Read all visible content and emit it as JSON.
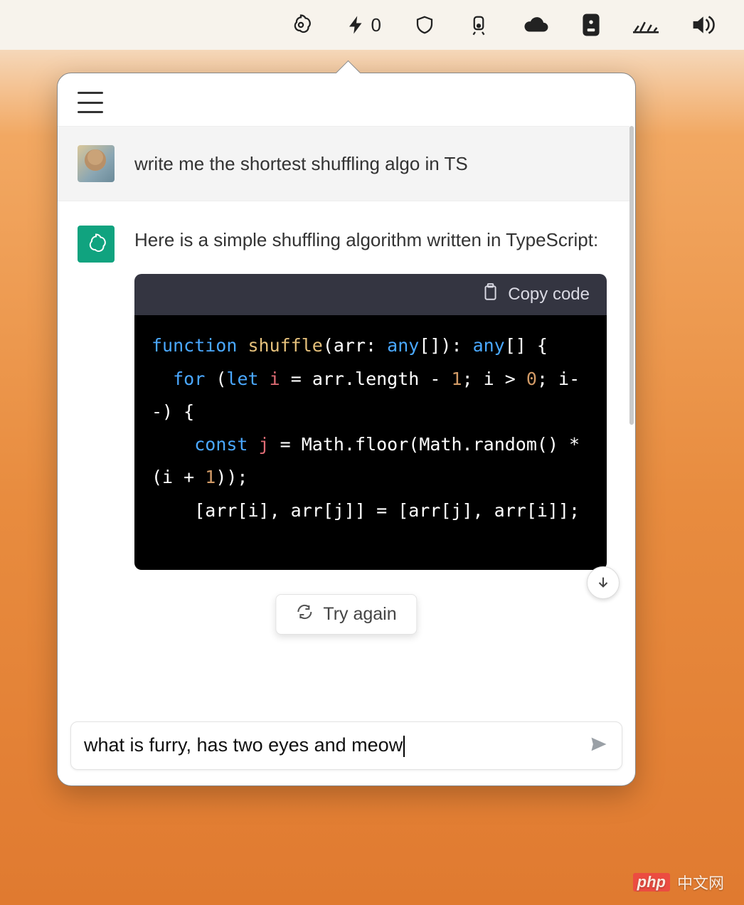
{
  "menubar": {
    "bolt_count": "0",
    "icons": [
      "openai-icon",
      "bolt-icon",
      "shield-icon",
      "train-icon",
      "cloud-icon",
      "badge-icon",
      "brightness-icon",
      "volume-icon"
    ]
  },
  "popover": {
    "header": {
      "menu_name": "hamburger-menu"
    }
  },
  "chat": {
    "user_message": "write me the shortest shuffling algo in TS",
    "ai_intro": "Here is a simple shuffling algorithm written in TypeScript:",
    "code": {
      "copy_label": "Copy code",
      "tokens": [
        {
          "t": "function ",
          "c": "b"
        },
        {
          "t": "shuffle",
          "c": "y"
        },
        {
          "t": "(arr: ",
          "c": "g"
        },
        {
          "t": "any",
          "c": "b"
        },
        {
          "t": "[]): ",
          "c": "g"
        },
        {
          "t": "any",
          "c": "b"
        },
        {
          "t": "[] {\n",
          "c": "g"
        },
        {
          "t": "  for ",
          "c": "b"
        },
        {
          "t": "(",
          "c": "g"
        },
        {
          "t": "let ",
          "c": "b"
        },
        {
          "t": "i",
          "c": "r"
        },
        {
          "t": " = arr.length - ",
          "c": "g"
        },
        {
          "t": "1",
          "c": "n"
        },
        {
          "t": "; i > ",
          "c": "g"
        },
        {
          "t": "0",
          "c": "n"
        },
        {
          "t": "; i--) {\n",
          "c": "g"
        },
        {
          "t": "    const ",
          "c": "b"
        },
        {
          "t": "j",
          "c": "r"
        },
        {
          "t": " = ",
          "c": "g"
        },
        {
          "t": "Math",
          "c": "g"
        },
        {
          "t": ".floor(",
          "c": "g"
        },
        {
          "t": "Math",
          "c": "g"
        },
        {
          "t": ".random() * (i + ",
          "c": "g"
        },
        {
          "t": "1",
          "c": "n"
        },
        {
          "t": "));\n",
          "c": "g"
        },
        {
          "t": "    [arr[i], arr[j]] = [arr[j], arr[i]];\n",
          "c": "g"
        }
      ]
    },
    "try_again_label": "Try again",
    "scroll_down_name": "scroll-down-button"
  },
  "input": {
    "value": "what is furry, has two eyes and meow",
    "send_name": "send-button"
  },
  "watermark": {
    "logo": "php",
    "text": "中文网"
  }
}
